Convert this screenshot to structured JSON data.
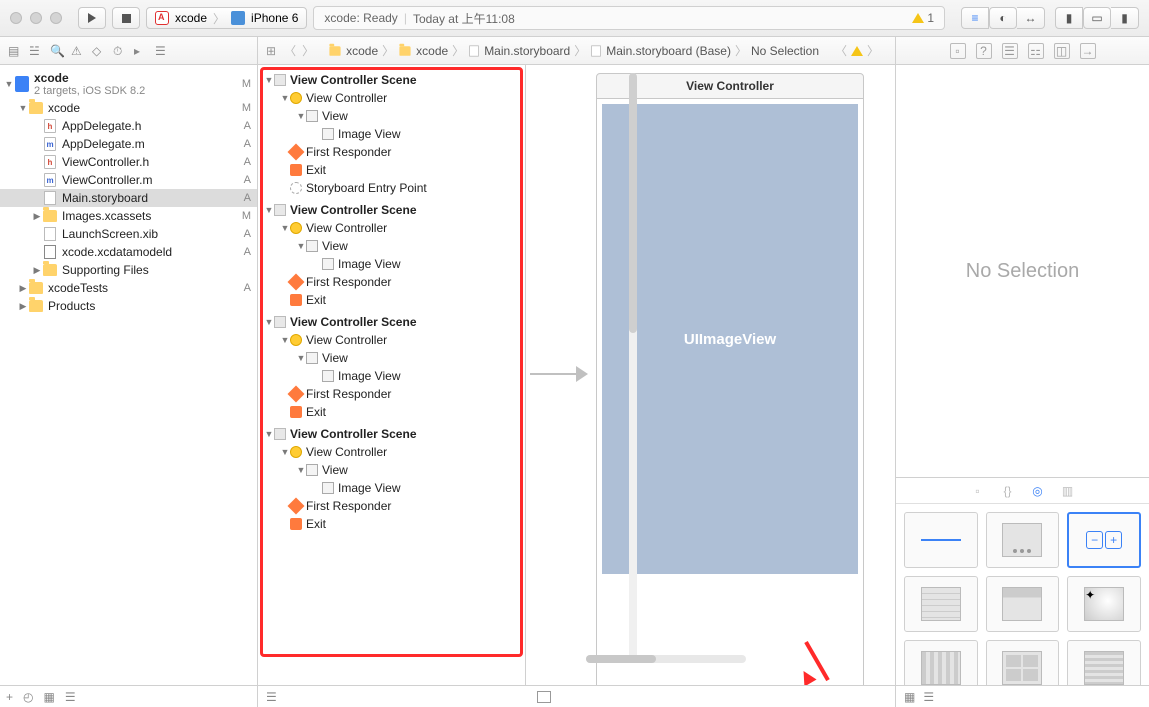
{
  "titlebar": {
    "scheme_app": "xcode",
    "scheme_device": "iPhone 6",
    "status_left": "xcode: Ready",
    "status_right": "Today at 上午11:08",
    "warning_count": "1"
  },
  "jumpbar": {
    "items": [
      "xcode",
      "xcode",
      "Main.storyboard",
      "Main.storyboard (Base)",
      "No Selection"
    ],
    "warning_count": "1"
  },
  "projnav": {
    "root": "xcode",
    "root_sub": "2 targets, iOS SDK 8.2",
    "root_badge": "M",
    "groups": [
      {
        "name": "xcode",
        "badge": "M",
        "children": [
          {
            "name": "AppDelegate.h",
            "kind": "h",
            "badge": "A"
          },
          {
            "name": "AppDelegate.m",
            "kind": "m",
            "badge": "A"
          },
          {
            "name": "ViewController.h",
            "kind": "h",
            "badge": "A"
          },
          {
            "name": "ViewController.m",
            "kind": "m",
            "badge": "A"
          },
          {
            "name": "Main.storyboard",
            "kind": "sb",
            "badge": "A",
            "selected": true
          },
          {
            "name": "Images.xcassets",
            "kind": "folder",
            "badge": "M"
          },
          {
            "name": "LaunchScreen.xib",
            "kind": "xib",
            "badge": "A"
          },
          {
            "name": "xcode.xcdatamodeld",
            "kind": "xc",
            "badge": "A"
          },
          {
            "name": "Supporting Files",
            "kind": "folder",
            "badge": ""
          }
        ]
      },
      {
        "name": "xcodeTests",
        "badge": "A",
        "children": []
      },
      {
        "name": "Products",
        "badge": "",
        "children": []
      }
    ]
  },
  "outline": {
    "scenes": [
      {
        "title": "View Controller Scene",
        "items": [
          "View Controller",
          "View",
          "Image View",
          "First Responder",
          "Exit",
          "Storyboard Entry Point"
        ]
      },
      {
        "title": "View Controller Scene",
        "items": [
          "View Controller",
          "View",
          "Image View",
          "First Responder",
          "Exit"
        ]
      },
      {
        "title": "View Controller Scene",
        "items": [
          "View Controller",
          "View",
          "Image View",
          "First Responder",
          "Exit"
        ]
      },
      {
        "title": "View Controller Scene",
        "items": [
          "View Controller",
          "View",
          "Image View",
          "First Responder",
          "Exit"
        ]
      }
    ]
  },
  "canvas": {
    "vc_title": "View Controller",
    "placeholder": "UIImageView"
  },
  "inspector": {
    "empty_text": "No Selection"
  },
  "library": {
    "items": [
      "line",
      "dots",
      "stepper",
      "rows",
      "rows2",
      "image",
      "grid1",
      "grid2",
      "grid3"
    ]
  }
}
